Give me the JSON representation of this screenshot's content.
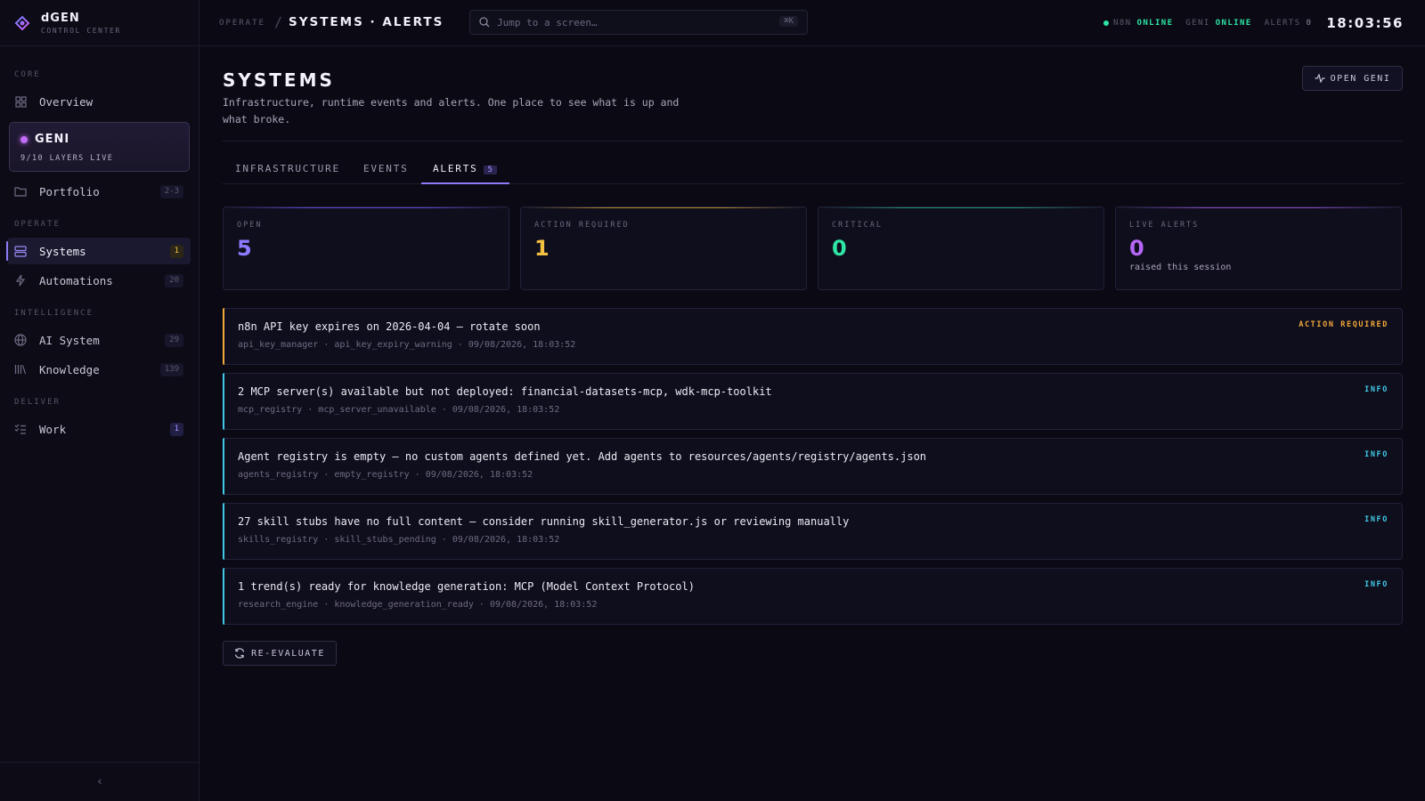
{
  "brand": {
    "name": "dGEN",
    "subtitle": "CONTROL CENTER"
  },
  "sidebar": {
    "sections": {
      "core": "CORE",
      "operate": "OPERATE",
      "intelligence": "INTELLIGENCE",
      "deliver": "DELIVER"
    },
    "overview": {
      "label": "Overview"
    },
    "geni": {
      "title": "GENI",
      "subtitle": "9/10 LAYERS LIVE"
    },
    "portfolio": {
      "label": "Portfolio",
      "badge": "2-3"
    },
    "systems": {
      "label": "Systems",
      "badge": "1"
    },
    "automations": {
      "label": "Automations",
      "badge": "20"
    },
    "ai_system": {
      "label": "AI System",
      "badge": "29"
    },
    "knowledge": {
      "label": "Knowledge",
      "badge": "139"
    },
    "work": {
      "label": "Work",
      "badge": "1"
    },
    "collapse_glyph": "‹"
  },
  "topbar": {
    "breadcrumb_section": "OPERATE",
    "breadcrumb_separator": "/",
    "breadcrumb_title": "SYSTEMS · ALERTS",
    "search_placeholder": "Jump to a screen…",
    "search_shortcut": "⌘K",
    "n8n_label": "N8N",
    "n8n_status": "ONLINE",
    "geni_label": "GENI",
    "geni_status": "ONLINE",
    "alerts_label": "ALERTS",
    "alerts_count": "0",
    "clock": "18:03:56"
  },
  "page": {
    "title": "SYSTEMS",
    "description": "Infrastructure, runtime events and alerts. One place to see what is up and what broke.",
    "open_geni_label": "OPEN GENI",
    "tabs": [
      {
        "label": "INFRASTRUCTURE"
      },
      {
        "label": "EVENTS"
      },
      {
        "label": "ALERTS",
        "count": "5"
      }
    ],
    "reevaluate_label": "RE-EVALUATE"
  },
  "stats": [
    {
      "label": "OPEN",
      "value": "5",
      "note": "",
      "color": "#8b7bff"
    },
    {
      "label": "ACTION REQUIRED",
      "value": "1",
      "note": "",
      "color": "#f2c043"
    },
    {
      "label": "CRITICAL",
      "value": "0",
      "note": "",
      "color": "#2ee6a4"
    },
    {
      "label": "LIVE ALERTS",
      "value": "0",
      "note": "raised this session",
      "color": "#b566f5"
    }
  ],
  "alerts": [
    {
      "title": "n8n API key expires on 2026-04-04 — rotate soon",
      "meta": "api_key_manager · api_key_expiry_warning · 09/08/2026, 18:03:52",
      "level": "ACTION REQUIRED",
      "color": "#f2a93b"
    },
    {
      "title": "2 MCP server(s) available but not deployed: financial-datasets-mcp, wdk-mcp-toolkit",
      "meta": "mcp_registry · mcp_server_unavailable · 09/08/2026, 18:03:52",
      "level": "INFO",
      "color": "#41c8e6"
    },
    {
      "title": "Agent registry is empty — no custom agents defined yet. Add agents to resources/agents/registry/agents.json",
      "meta": "agents_registry · empty_registry · 09/08/2026, 18:03:52",
      "level": "INFO",
      "color": "#41c8e6"
    },
    {
      "title": "27 skill stubs have no full content — consider running skill_generator.js or reviewing manually",
      "meta": "skills_registry · skill_stubs_pending · 09/08/2026, 18:03:52",
      "level": "INFO",
      "color": "#41c8e6"
    },
    {
      "title": "1 trend(s) ready for knowledge generation: MCP (Model Context Protocol)",
      "meta": "research_engine · knowledge_generation_ready · 09/08/2026, 18:03:52",
      "level": "INFO",
      "color": "#41c8e6"
    }
  ]
}
